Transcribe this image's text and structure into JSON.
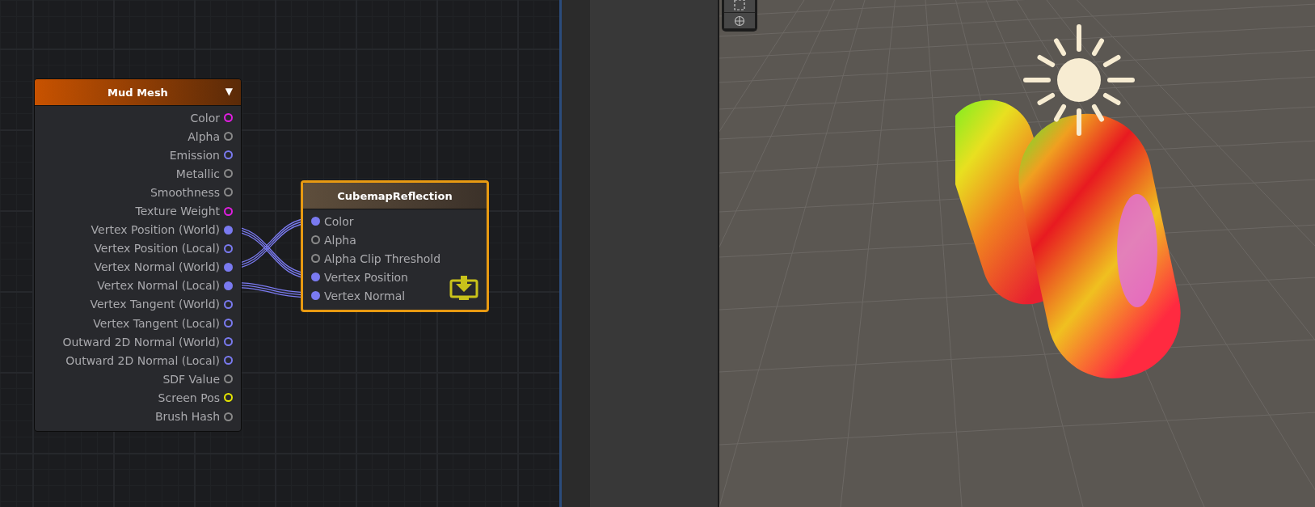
{
  "graph": {
    "nodes": [
      {
        "kind": "outputs",
        "title": "Mud Mesh",
        "menu_glyph": "▼",
        "color": "#c85200",
        "selected": false,
        "ports": [
          {
            "label": "Color",
            "color": "#e01ee0",
            "connected": false
          },
          {
            "label": "Alpha",
            "color": "#8a8a8a",
            "connected": false
          },
          {
            "label": "Emission",
            "color": "#7a7af0",
            "connected": false
          },
          {
            "label": "Metallic",
            "color": "#8a8a8a",
            "connected": false
          },
          {
            "label": "Smoothness",
            "color": "#8a8a8a",
            "connected": false
          },
          {
            "label": "Texture Weight",
            "color": "#e01ee0",
            "connected": false
          },
          {
            "label": "Vertex Position (World)",
            "color": "#7a7af0",
            "connected": true
          },
          {
            "label": "Vertex Position (Local)",
            "color": "#7a7af0",
            "connected": false
          },
          {
            "label": "Vertex Normal (World)",
            "color": "#7a7af0",
            "connected": true
          },
          {
            "label": "Vertex Normal (Local)",
            "color": "#7a7af0",
            "connected": true
          },
          {
            "label": "Vertex Tangent (World)",
            "color": "#7a7af0",
            "connected": false
          },
          {
            "label": "Vertex Tangent (Local)",
            "color": "#7a7af0",
            "connected": false
          },
          {
            "label": "Outward 2D Normal (World)",
            "color": "#7a7af0",
            "connected": false
          },
          {
            "label": "Outward 2D Normal (Local)",
            "color": "#7a7af0",
            "connected": false
          },
          {
            "label": "SDF Value",
            "color": "#8a8a8a",
            "connected": false
          },
          {
            "label": "Screen Pos",
            "color": "#e6e600",
            "connected": false
          },
          {
            "label": "Brush Hash",
            "color": "#8a8a8a",
            "connected": false
          }
        ]
      },
      {
        "kind": "inputs",
        "title": "CubemapReflection",
        "color": "#5e4e3c",
        "selected": true,
        "ports": [
          {
            "label": "Color",
            "color": "#7a7af0",
            "connected": true
          },
          {
            "label": "Alpha",
            "color": "#8a8a8a",
            "connected": false
          },
          {
            "label": "Alpha Clip Threshold",
            "color": "#8a8a8a",
            "connected": false
          },
          {
            "label": "Vertex Position",
            "color": "#7a7af0",
            "connected": true
          },
          {
            "label": "Vertex Normal",
            "color": "#7a7af0",
            "connected": true
          }
        ]
      }
    ],
    "wires_crossed": true
  }
}
